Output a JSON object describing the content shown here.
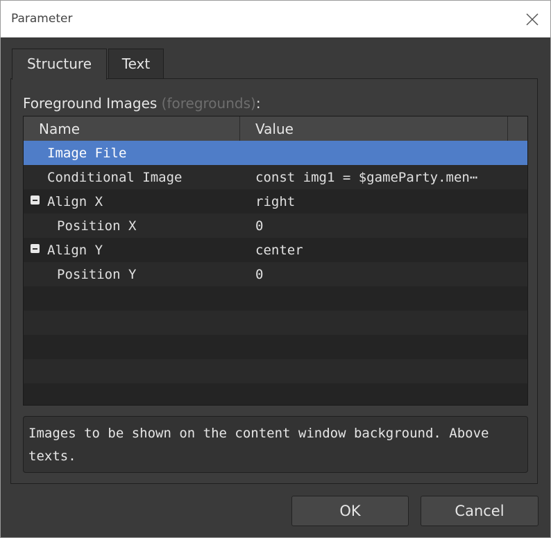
{
  "window": {
    "title": "Parameter"
  },
  "tabs": [
    {
      "label": "Structure",
      "active": true
    },
    {
      "label": "Text",
      "active": false
    }
  ],
  "section": {
    "label": "Foreground Images",
    "hint": "(foregrounds)",
    "suffix": ":"
  },
  "grid": {
    "headers": {
      "name": "Name",
      "value": "Value"
    },
    "rows": [
      {
        "name": "Image File",
        "value": "",
        "selected": true,
        "indent": 1,
        "expandable": false
      },
      {
        "name": "Conditional Image",
        "value": "const img1 = $gameParty.men⋯",
        "selected": false,
        "indent": 1,
        "expandable": false
      },
      {
        "name": "Align X",
        "value": "right",
        "selected": false,
        "indent": 1,
        "expandable": true
      },
      {
        "name": "Position X",
        "value": "0",
        "selected": false,
        "indent": 2,
        "expandable": false
      },
      {
        "name": "Align Y",
        "value": "center",
        "selected": false,
        "indent": 1,
        "expandable": true
      },
      {
        "name": "Position Y",
        "value": "0",
        "selected": false,
        "indent": 2,
        "expandable": false
      }
    ]
  },
  "description": "Images to be shown on the content window background. Above texts.",
  "buttons": {
    "ok": "OK",
    "cancel": "Cancel"
  },
  "colors": {
    "selection": "#4f7dc8",
    "background": "#3a3a3a"
  }
}
